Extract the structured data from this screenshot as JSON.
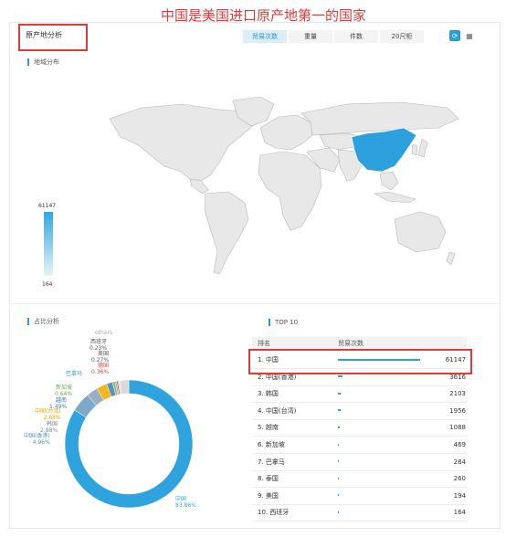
{
  "headline": "中国是美国进口原产地第一的国家",
  "panel_title": "原产地分析",
  "tabs": [
    "贸易次数",
    "重量",
    "件数",
    "20尺柜"
  ],
  "map_section": {
    "title": "地域分布",
    "legend_max": "61147",
    "legend_min": "164",
    "highlight_color": "#2c9fdd"
  },
  "pie_section": {
    "title": "占比分析"
  },
  "top_section": {
    "title": "TOP 10",
    "col_rank": "排名",
    "col_count": "贸易次数"
  },
  "rows": [
    {
      "name": "1. 中国",
      "value": "61147",
      "num": 61147
    },
    {
      "name": "2. 中国(香港)",
      "value": "3616",
      "num": 3616
    },
    {
      "name": "3. 韩国",
      "value": "2103",
      "num": 2103
    },
    {
      "name": "4. 中国(台湾)",
      "value": "1956",
      "num": 1956
    },
    {
      "name": "5. 越南",
      "value": "1088",
      "num": 1088
    },
    {
      "name": "6. 新加坡",
      "value": "469",
      "num": 469
    },
    {
      "name": "7. 巴拿马",
      "value": "284",
      "num": 284
    },
    {
      "name": "8. 泰国",
      "value": "260",
      "num": 260
    },
    {
      "name": "9. 美国",
      "value": "194",
      "num": 194
    },
    {
      "name": "10. 西班牙",
      "value": "164",
      "num": 164
    }
  ],
  "pie_labels": {
    "others": "others",
    "spain": "西班牙",
    "spain_pct": "0.23%",
    "usa": "美国",
    "usa_pct": "0.27%",
    "de": "德国",
    "de_pct": "0.36%",
    "panama": "巴拿马",
    "sg": "新加坡",
    "sg_pct": "0.64%",
    "vn": "越南",
    "vn_pct": "1.49%",
    "tw": "中国(台湾)",
    "tw_pct": "2.68%",
    "kr": "韩国",
    "kr_pct": "2.88%",
    "hk": "中国(香港)",
    "hk_pct": "4.96%",
    "cn": "中国",
    "cn_pct": "83.86%"
  },
  "chart_data": {
    "type": "pie",
    "title": "",
    "categories": [
      "中国",
      "中国(香港)",
      "韩国",
      "中国(台湾)",
      "越南",
      "新加坡",
      "巴拿马",
      "德国",
      "美国",
      "西班牙",
      "others"
    ],
    "values": [
      83.86,
      4.96,
      2.88,
      2.68,
      1.49,
      0.64,
      0.39,
      0.36,
      0.27,
      0.23,
      2.24
    ],
    "colors": [
      "#2ea3de",
      "#7aa9c9",
      "#9ab0c2",
      "#f2b81b",
      "#5a8fc7",
      "#8fc057",
      "#6ab3d7",
      "#e04d4d",
      "#b7b7b7",
      "#cfcfcf",
      "#dadada"
    ]
  }
}
